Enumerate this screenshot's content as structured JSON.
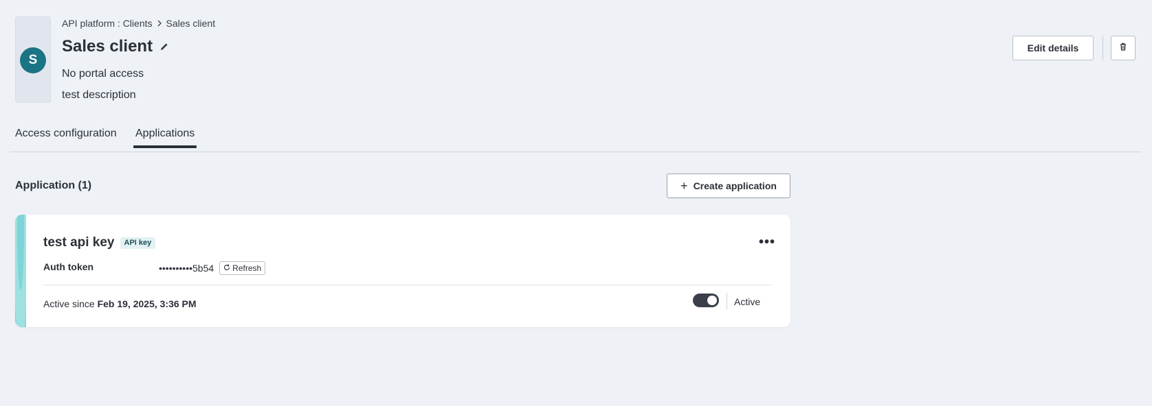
{
  "breadcrumb": {
    "parent": "API platform : Clients",
    "current": "Sales client"
  },
  "header": {
    "avatar_letter": "S",
    "avatar_color": "#1a7484",
    "title": "Sales client",
    "portal_access": "No portal access",
    "description": "test description",
    "edit_label": "Edit details"
  },
  "tabs": [
    {
      "label": "Access configuration",
      "active": false
    },
    {
      "label": "Applications",
      "active": true
    }
  ],
  "section": {
    "title": "Application (1)",
    "create_label": "Create application"
  },
  "application": {
    "name": "test api key",
    "badge": "API key",
    "auth_label": "Auth token",
    "token": "••••••••••5b54",
    "refresh_label": "Refresh",
    "active_since_prefix": "Active since",
    "active_since_date": "Feb 19, 2025, 3:36 PM",
    "status": "Active",
    "toggle_on": true
  },
  "icons": {
    "edit": "pencil-icon",
    "delete": "trash-icon",
    "more": "more-horizontal-icon",
    "add": "plus-icon",
    "refresh": "refresh-icon",
    "separator": "chevron-right-icon"
  }
}
